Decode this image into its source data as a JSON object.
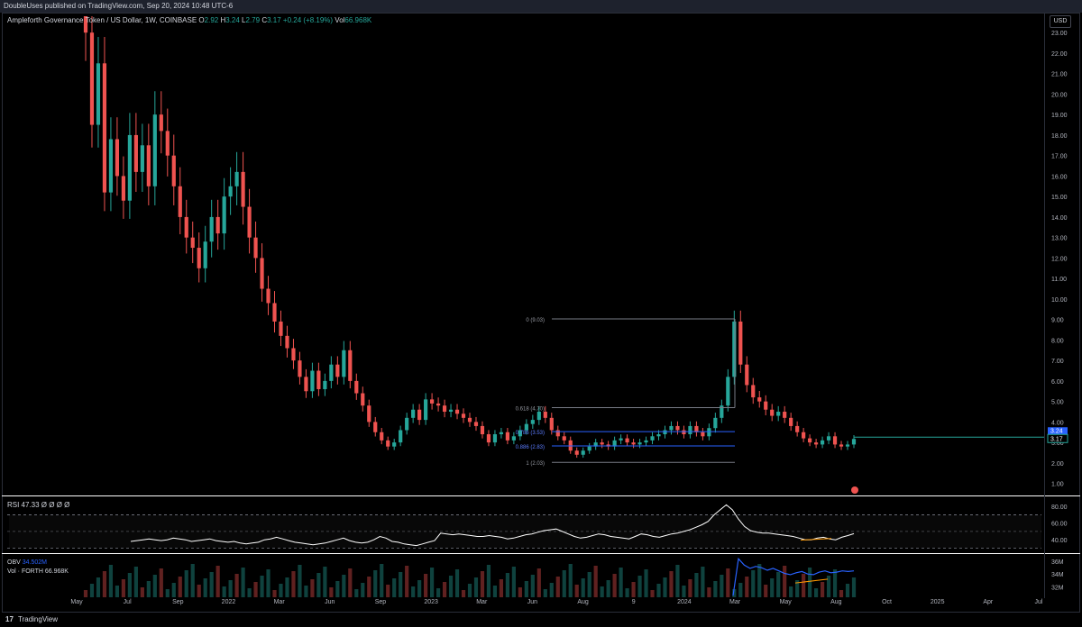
{
  "header": {
    "publisher_text": "DoubleUses published on TradingView.com, Sep 20, 2024 10:48 UTC-6"
  },
  "legend": {
    "symbol": "Ampleforth Governance Token / US Dollar, 1W, COINBASE",
    "o_label": "O",
    "o_val": "2.92",
    "h_label": "H",
    "h_val": "3.24",
    "l_label": "L",
    "l_val": "2.79",
    "c_label": "C",
    "c_val": "3.17",
    "chg": "+0.24 (+8.19%)",
    "vol_label": "Vol",
    "vol_val": "66.968K"
  },
  "currency": "USD",
  "rsi_legend": "RSI 47.33 Ø Ø Ø Ø",
  "obv_legend": {
    "label": "OBV",
    "value": "34.502M"
  },
  "vol_legend": {
    "label": "Vol · FORTH",
    "value": "66.968K"
  },
  "footer": {
    "brand": "TradingView",
    "logo": "17"
  },
  "colors": {
    "up": "#26a69a",
    "down": "#ef5350",
    "rsi": "#ffffff",
    "obv": "#2962ff",
    "divergence": "#ff9800",
    "fib": "#787b86",
    "fib_blue": "#2962ff",
    "price_line": "#26a69a"
  },
  "chart_data": {
    "type": "candlestick",
    "title": "Ampleforth Governance Token / US Dollar, 1W, COINBASE",
    "price_axis": {
      "ticks": [
        "23.00",
        "22.00",
        "21.00",
        "20.00",
        "19.00",
        "18.00",
        "17.00",
        "16.00",
        "15.00",
        "14.00",
        "13.00",
        "12.00",
        "11.00",
        "10.00",
        "9.00",
        "8.00",
        "7.00",
        "6.00",
        "5.00",
        "4.00",
        "3.00",
        "2.00",
        "1.00"
      ],
      "ylim": [
        0.5,
        23.8
      ],
      "current_price": "3.17",
      "current_label_top": "3.24"
    },
    "time_axis": {
      "ticks": [
        "May",
        "Jul",
        "Sep",
        "2022",
        "Mar",
        "Jun",
        "Sep",
        "2023",
        "Mar",
        "Jun",
        "Aug",
        "9",
        "2024",
        "Mar",
        "May",
        "Aug",
        "Oct",
        "2025",
        "Apr",
        "Jul"
      ]
    },
    "series_close": [
      23.0,
      18.5,
      21.5,
      15.2,
      17.8,
      16.0,
      14.8,
      18.0,
      16.2,
      17.5,
      15.5,
      19.0,
      18.2,
      17.0,
      15.5,
      14.0,
      13.0,
      12.5,
      11.5,
      12.8,
      14.0,
      13.2,
      15.0,
      15.5,
      16.2,
      14.5,
      13.0,
      12.0,
      10.5,
      9.8,
      8.9,
      8.2,
      7.6,
      7.0,
      6.2,
      5.5,
      6.5,
      5.6,
      6.0,
      6.8,
      6.2,
      7.5,
      6.0,
      5.4,
      4.8,
      4.0,
      3.5,
      3.1,
      2.8,
      3.0,
      3.6,
      4.2,
      4.6,
      4.1,
      5.1,
      4.9,
      4.8,
      4.5,
      4.6,
      4.4,
      4.2,
      4.0,
      3.8,
      3.4,
      3.0,
      3.4,
      3.5,
      3.1,
      3.3,
      3.6,
      3.9,
      4.1,
      4.5,
      4.2,
      3.6,
      3.3,
      3.1,
      2.6,
      2.4,
      2.6,
      2.8,
      3.0,
      2.9,
      2.8,
      3.1,
      3.2,
      3.0,
      2.9,
      3.0,
      3.1,
      3.3,
      3.4,
      3.6,
      3.8,
      3.6,
      3.4,
      3.8,
      3.5,
      3.3,
      3.7,
      4.2,
      4.8,
      6.2,
      8.9,
      6.8,
      5.8,
      5.2,
      5.0,
      4.6,
      4.3,
      4.5,
      4.2,
      3.8,
      3.5,
      3.2,
      3.0,
      2.9,
      3.1,
      3.3,
      2.9,
      2.8,
      2.9,
      3.17
    ],
    "fibonacci": [
      {
        "label": "0 (9.03)",
        "price": 9.03
      },
      {
        "label": "0.618 (4.70)",
        "price": 4.7
      },
      {
        "label": "0.786 (3.53)",
        "price": 3.53
      },
      {
        "label": "0.886 (2.83)",
        "price": 2.83
      },
      {
        "label": "1 (2.03)",
        "price": 2.03
      }
    ],
    "rsi": {
      "name": "RSI",
      "value": 47.33,
      "ticks": [
        "80.00",
        "60.00",
        "40.00"
      ],
      "bands": [
        70,
        30
      ],
      "ylim": [
        25,
        90
      ],
      "values": [
        38,
        39,
        40,
        41,
        40,
        39,
        40,
        42,
        41,
        40,
        38,
        39,
        40,
        41,
        39,
        38,
        37,
        38,
        36,
        35,
        36,
        37,
        40,
        41,
        43,
        41,
        39,
        37,
        36,
        35,
        34,
        35,
        36,
        38,
        40,
        42,
        39,
        37,
        36,
        37,
        40,
        44,
        42,
        38,
        37,
        35,
        34,
        33,
        35,
        37,
        39,
        48,
        47,
        46,
        47,
        46,
        45,
        44,
        44,
        45,
        44,
        43,
        41,
        42,
        44,
        46,
        47,
        49,
        51,
        52,
        53,
        50,
        47,
        44,
        42,
        43,
        45,
        47,
        46,
        44,
        43,
        42,
        41,
        44,
        47,
        46,
        44,
        43,
        45,
        47,
        48,
        50,
        52,
        55,
        58,
        62,
        70,
        76,
        82,
        76,
        65,
        56,
        51,
        49,
        48,
        48,
        47,
        46,
        45,
        44,
        42,
        40,
        40,
        42,
        43,
        41,
        40,
        43,
        45,
        47.33
      ]
    },
    "obv": {
      "name": "OBV",
      "value": "34.502M",
      "ticks": [
        "36M",
        "34M",
        "32M"
      ],
      "ylim": [
        30.5,
        37
      ],
      "values": [
        36.4,
        35.4,
        34.9,
        35.2,
        35.0,
        34.6,
        34.9,
        34.5,
        34.1,
        33.9,
        34.2,
        34.4,
        34.0,
        33.9,
        34.3,
        34.5,
        34.2,
        34.3,
        34.5,
        34.4,
        34.502
      ]
    },
    "volume": {
      "name": "Vol · FORTH",
      "value": "66.968K"
    }
  }
}
